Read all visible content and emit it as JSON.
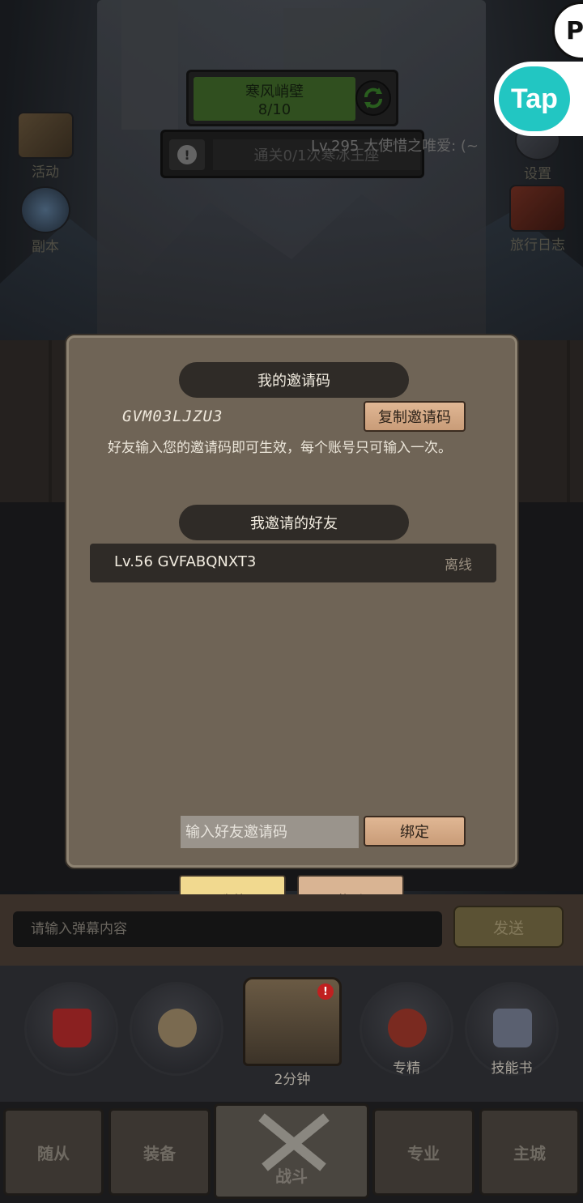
{
  "hud": {
    "stage_name": "寒风峭壁",
    "stage_progress": "8/10",
    "quest_text": "通关0/1次寒冰王座",
    "player_line": "Lv.295 大使惜之唯爱: (~"
  },
  "side_left": [
    {
      "label": "活动"
    },
    {
      "label": "副本"
    }
  ],
  "side_right": [
    {
      "label": "设置"
    },
    {
      "label": "旅行日志"
    }
  ],
  "badges": {
    "tap": "Tap",
    "p": "P"
  },
  "dialog": {
    "my_code_title": "我的邀请码",
    "my_code_value": "GVM03LJZU3",
    "copy_button": "复制邀请码",
    "hint": "好友输入您的邀请码即可生效，每个账号只可输入一次。",
    "friends_title": "我邀请的好友",
    "friends": [
      {
        "name": "Lv.56 GVFABQNXT3",
        "status": "离线"
      }
    ],
    "input_placeholder": "输入好友邀请码",
    "bind_button": "绑定"
  },
  "tabs": [
    {
      "label": "我的",
      "active": true
    },
    {
      "label": "奖励",
      "active": false
    }
  ],
  "chat": {
    "placeholder": "请输入弹幕内容",
    "send_button": "发送"
  },
  "skills": {
    "chest_timer": "2分钟",
    "chest_badge": "!",
    "items": [
      {
        "label": ""
      },
      {
        "label": ""
      },
      {
        "label": "专精"
      },
      {
        "label": "技能书"
      }
    ]
  },
  "bottom_nav": [
    {
      "label": "随从"
    },
    {
      "label": "装备"
    },
    {
      "label": "战斗"
    },
    {
      "label": "专业"
    },
    {
      "label": "主城"
    }
  ]
}
